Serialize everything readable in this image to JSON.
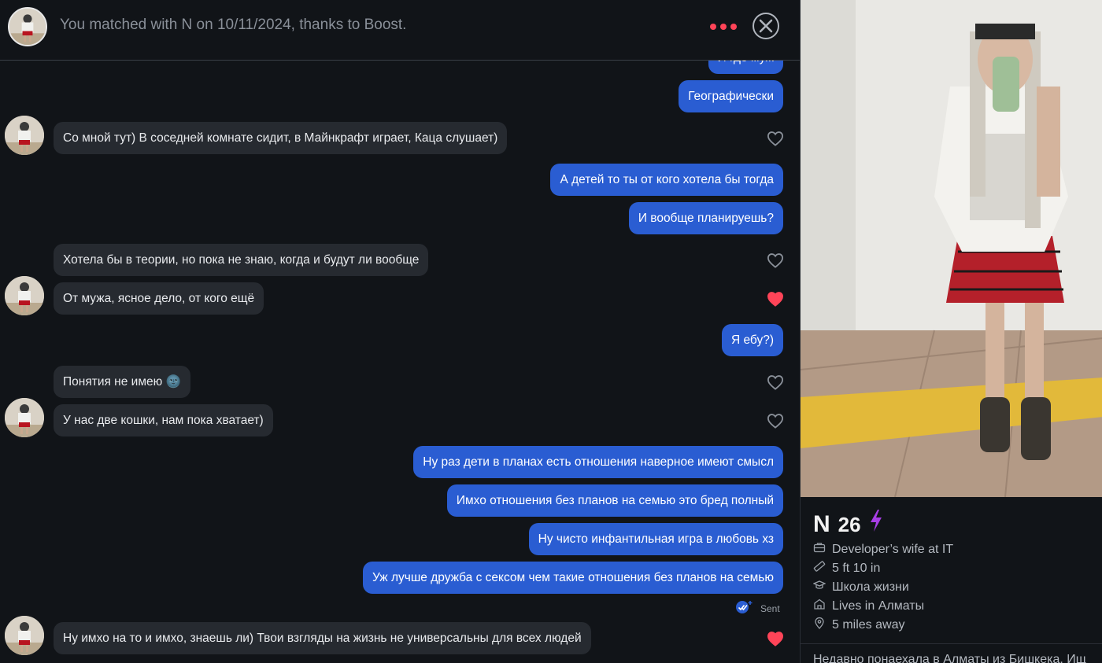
{
  "header": {
    "match_text": "You matched with N on 10/11/2024, thanks to Boost."
  },
  "messages": [
    {
      "dir": "out",
      "text": "И где муж"
    },
    {
      "dir": "out",
      "text": "Географически"
    },
    {
      "dir": "in",
      "text": "Со мной тут) В соседней комнате сидит, в Майнкрафт играет, Каца слушает)",
      "liked": false
    },
    {
      "dir": "out",
      "text": "А детей то ты от кого хотела бы тогда"
    },
    {
      "dir": "out",
      "text": "И вообще планируешь?"
    },
    {
      "dir": "in",
      "text": "Хотела бы в теории, но пока не знаю, когда и будут ли вообще",
      "liked": false
    },
    {
      "dir": "in",
      "text": "От мужа, ясное дело, от кого ещё",
      "liked": true
    },
    {
      "dir": "out",
      "text": "Я ебу?)"
    },
    {
      "dir": "in",
      "text": "Понятия не имею 🌚",
      "liked": false
    },
    {
      "dir": "in",
      "text": "У нас две кошки, нам пока хватает)",
      "liked": false
    },
    {
      "dir": "out",
      "text": "Ну раз дети в планах есть отношения наверное имеют смысл"
    },
    {
      "dir": "out",
      "text": "Имхо отношения без планов на семью это бред полный"
    },
    {
      "dir": "out",
      "text": "Ну чисто инфантильная игра в любовь хз"
    },
    {
      "dir": "out",
      "text": "Уж лучше дружба с сексом чем такие отношения без планов на семью"
    },
    {
      "dir": "in",
      "text": "Ну имхо на то и имхо, знаешь ли) Твои взгляды на жизнь не универсальны для всех людей",
      "liked": true
    }
  ],
  "status": {
    "sent_label": "Sent"
  },
  "profile": {
    "name": "N",
    "age": "26",
    "job": "Developer’s wife at IT",
    "height": "5 ft 10 in",
    "school": "Школа жизни",
    "lives": "Lives in Алматы",
    "distance": "5 miles away",
    "bio": "Недавно понаехала в Алматы из Бишкека. Ищ"
  },
  "colors": {
    "accent_red": "#ff4458",
    "outgoing_bubble": "#2a5dd2",
    "incoming_bubble": "#262a30",
    "boost_purple": "#a83ee6"
  },
  "icons": {
    "more": "more-dots-icon",
    "close": "close-icon",
    "like": "heart-icon",
    "boost": "lightning-icon",
    "job": "briefcase-icon",
    "height": "ruler-icon",
    "school": "graduation-cap-icon",
    "home": "house-icon",
    "location": "location-pin-icon",
    "sent": "double-check-icon"
  }
}
